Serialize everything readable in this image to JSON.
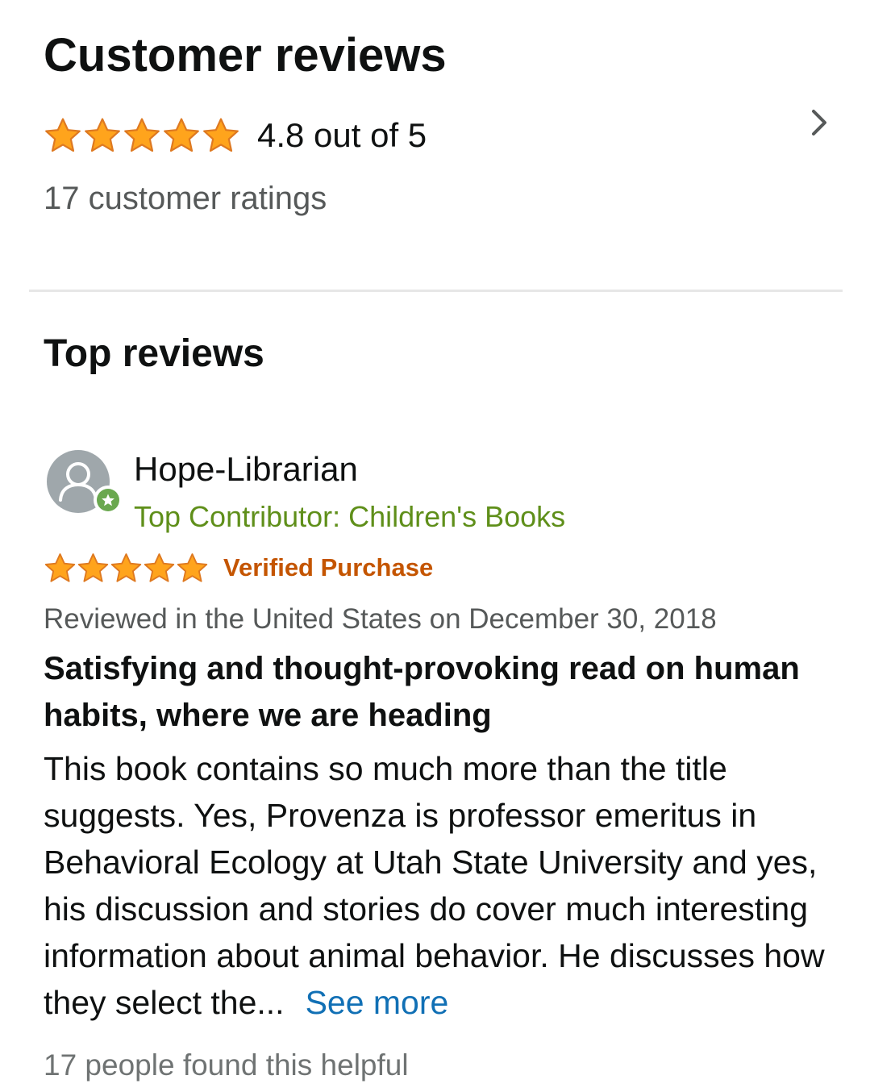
{
  "summary": {
    "title": "Customer reviews",
    "rating_value": 4.8,
    "rating_text": "4.8 out of 5",
    "ratings_count": "17 customer ratings",
    "icons": {
      "stars": "star-icon",
      "chevron": "chevron-right-icon"
    }
  },
  "top_reviews": {
    "title": "Top reviews"
  },
  "review": {
    "reviewer_name": "Hope-Librarian",
    "contributor_badge": "Top Contributor: Children's Books",
    "stars": 5,
    "verified": "Verified Purchase",
    "date": "Reviewed in the United States on December 30, 2018",
    "title": "Satisfying and thought-provoking read on human habits, where we are heading",
    "body": "This book contains so much more than the title suggests. Yes, Provenza is professor emeritus in Behavioral Ecology at Utah State University and yes, his discussion and stories do cover much interesting information about animal behavior. He discusses how they select the...",
    "see_more": "See more",
    "helpful": "17 people found this helpful"
  },
  "colors": {
    "star_fill": "#FFA41C",
    "star_stroke": "#DE7921",
    "verified": "#C45500",
    "contributor": "#5F8F1A",
    "link": "#1170B5",
    "secondary_text": "#565959",
    "divider": "#E7E7E7",
    "avatar_bg": "#9FA7AB",
    "badge_green": "#6AA84F"
  }
}
